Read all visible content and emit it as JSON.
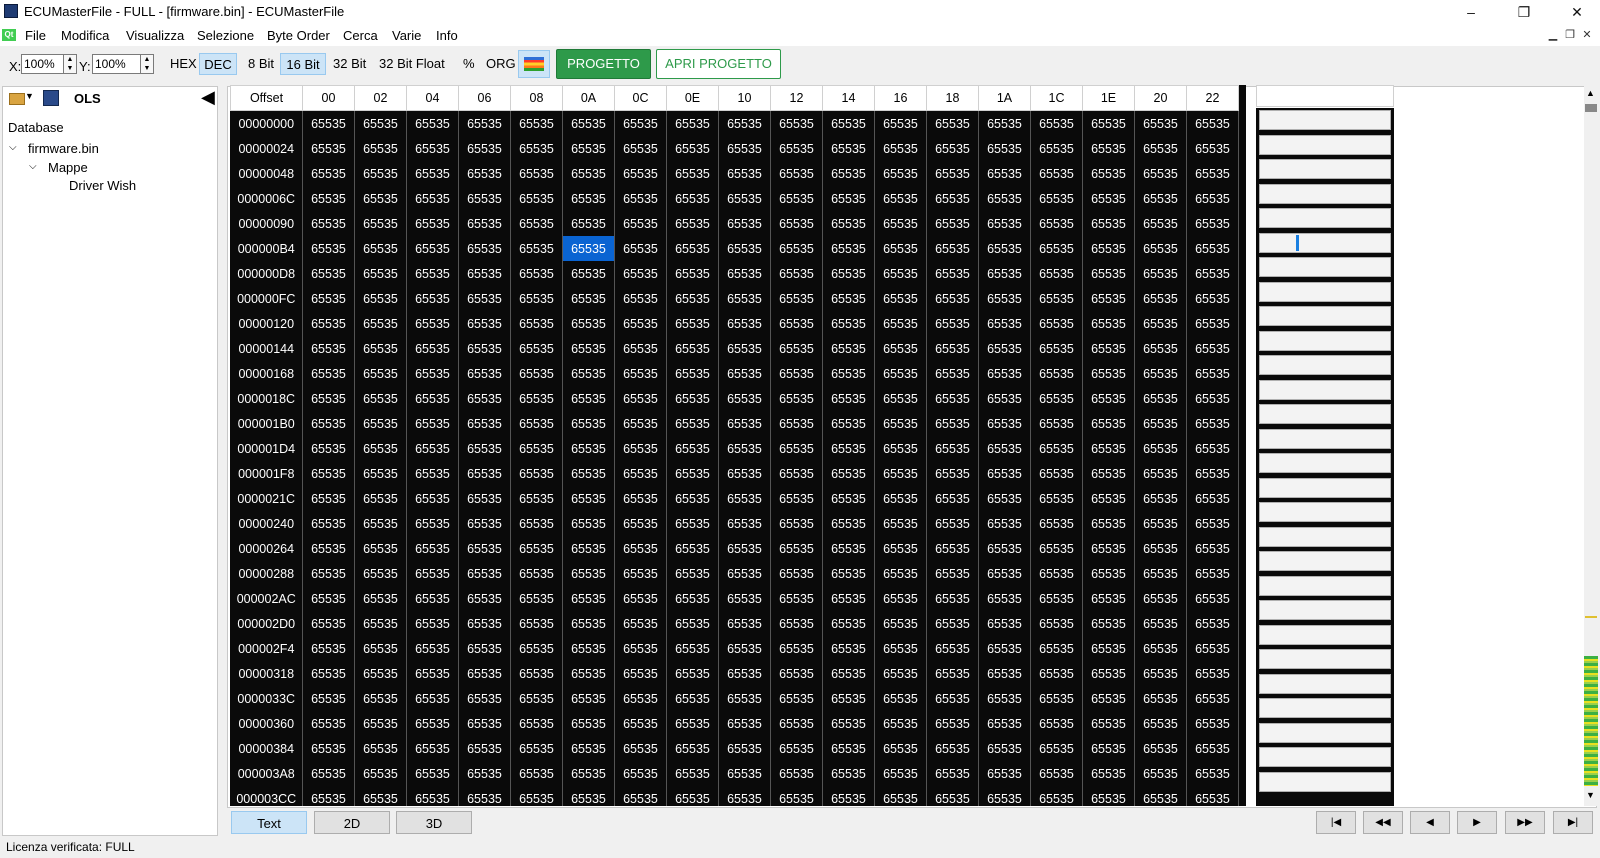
{
  "window": {
    "title": "ECUMasterFile - FULL - [firmware.bin] - ECUMasterFile",
    "minimize_glyph": "–",
    "restore_glyph": "❐",
    "close_glyph": "✕"
  },
  "menu": {
    "qt_badge": "Qt",
    "items": [
      "File",
      "Modifica",
      "Visualizza",
      "Selezione",
      "Byte Order",
      "Cerca",
      "Varie",
      "Info"
    ]
  },
  "toolbar": {
    "x_label": "X:",
    "x_value": "100%",
    "y_label": "Y:",
    "y_value": "100%",
    "hex": "HEX",
    "dec": "DEC",
    "bit8": "8 Bit",
    "bit16": "16 Bit",
    "bit32": "32 Bit",
    "bit32f": "32 Bit Float",
    "percent": "%",
    "org": "ORG",
    "progetto": "PROGETTO",
    "apri_progetto": "APRI PROGETTO",
    "colors": {
      "progetto_bg": "#2e9a4a",
      "selection": "#0a64d2",
      "grid_bg": "#0a0a0a"
    }
  },
  "sidebar": {
    "header": "OLS",
    "database_label": "Database",
    "tree": {
      "file": "firmware.bin",
      "folder": "Mappe",
      "map": "Driver Wish"
    }
  },
  "grid": {
    "offset_header": "Offset",
    "columns": [
      "00",
      "02",
      "04",
      "06",
      "08",
      "0A",
      "0C",
      "0E",
      "10",
      "12",
      "14",
      "16",
      "18",
      "1A",
      "1C",
      "1E",
      "20",
      "22"
    ],
    "offsets": [
      "00000000",
      "00000024",
      "00000048",
      "0000006C",
      "00000090",
      "000000B4",
      "000000D8",
      "000000FC",
      "00000120",
      "00000144",
      "00000168",
      "0000018C",
      "000001B0",
      "000001D4",
      "000001F8",
      "0000021C",
      "00000240",
      "00000264",
      "00000288",
      "000002AC",
      "000002D0",
      "000002F4",
      "00000318",
      "0000033C",
      "00000360",
      "00000384",
      "000003A8",
      "000003CC"
    ],
    "cell_value": "65535",
    "selected_row": 5,
    "selected_col": 5
  },
  "view_tabs": [
    "Text",
    "2D",
    "3D"
  ],
  "nav_buttons": [
    "|◀",
    "◀◀",
    "◀",
    "▶",
    "▶▶",
    "▶|"
  ],
  "status": "Licenza verificata: FULL"
}
